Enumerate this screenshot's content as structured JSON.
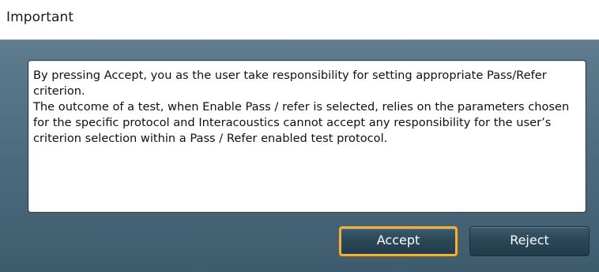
{
  "dialog": {
    "title": "Important",
    "message": "By pressing Accept, you as the user take responsibility for setting appropriate Pass/Refer criterion.\nThe outcome of a test, when Enable Pass / refer is selected, relies on the parameters chosen for the specific protocol and Interacoustics cannot accept any responsibility for the user’s criterion selection within a Pass / Refer enabled test protocol.",
    "accept_label": "Accept",
    "reject_label": "Reject"
  },
  "colors": {
    "panel": "#4d6b7e",
    "button": "#2c4858",
    "focus_border": "#e8b24a"
  }
}
